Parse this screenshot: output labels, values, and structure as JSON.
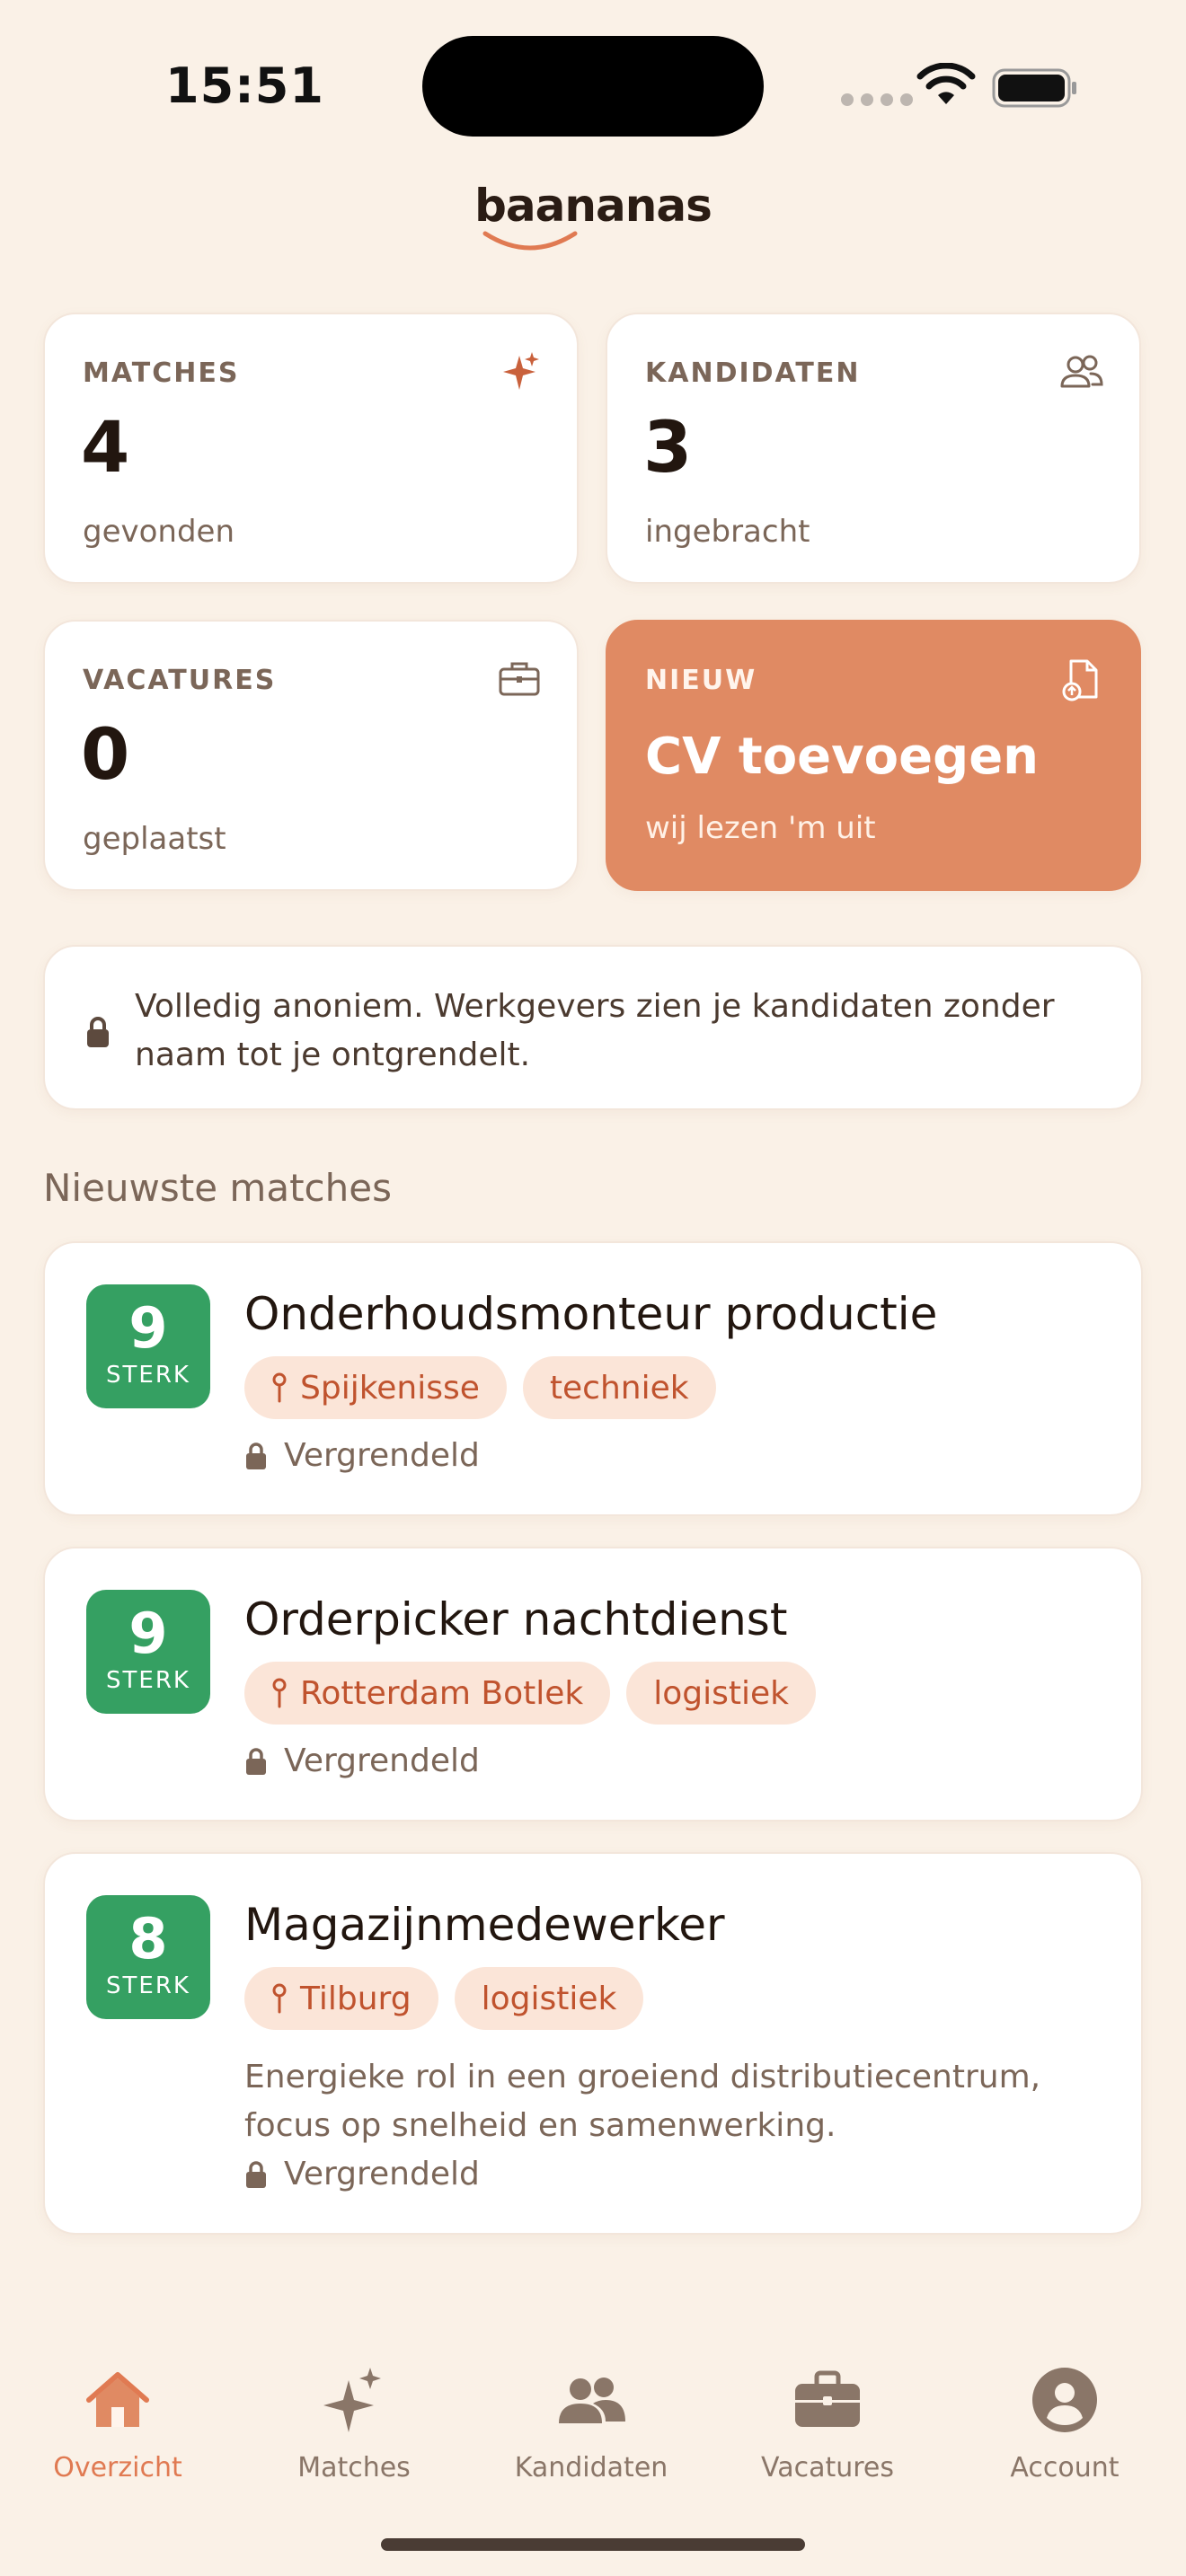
{
  "status_bar": {
    "time": "15:51"
  },
  "app": {
    "logo": "baananas"
  },
  "stats": [
    {
      "label": "MATCHES",
      "value": "4",
      "sub": "gevonden",
      "icon": "sparkle-icon"
    },
    {
      "label": "KANDIDATEN",
      "value": "3",
      "sub": "ingebracht",
      "icon": "people-icon"
    },
    {
      "label": "VACATURES",
      "value": "0",
      "sub": "geplaatst",
      "icon": "briefcase-icon"
    }
  ],
  "cta": {
    "label": "NIEUW",
    "title": "CV toevoegen",
    "sub": "wij lezen 'm uit",
    "icon": "file-upload-icon"
  },
  "notice": {
    "text": "Volledig anoniem. Werkgevers zien je kandidaten zonder naam tot je ontgrendelt.",
    "icon": "lock-icon"
  },
  "section": {
    "title": "Nieuwste matches"
  },
  "matches": [
    {
      "score": "9",
      "score_label": "STERK",
      "title": "Onderhoudsmonteur productie",
      "location": "Spijkenisse",
      "category": "techniek",
      "description": "",
      "status": "Vergrendeld"
    },
    {
      "score": "9",
      "score_label": "STERK",
      "title": "Orderpicker nachtdienst",
      "location": "Rotterdam Botlek",
      "category": "logistiek",
      "description": "",
      "status": "Vergrendeld"
    },
    {
      "score": "8",
      "score_label": "STERK",
      "title": "Magazijnmedewerker",
      "location": "Tilburg",
      "category": "logistiek",
      "description": "Energieke rol in een groeiend distributiecentrum, focus op snelheid en samenwerking.",
      "status": "Vergrendeld"
    }
  ],
  "tabbar": {
    "items": [
      {
        "label": "Overzicht",
        "icon": "house-icon",
        "active": true
      },
      {
        "label": "Matches",
        "icon": "sparkle-icon",
        "active": false
      },
      {
        "label": "Kandidaten",
        "icon": "people-icon",
        "active": false
      },
      {
        "label": "Vacatures",
        "icon": "briefcase-icon",
        "active": false
      },
      {
        "label": "Account",
        "icon": "account-icon",
        "active": false
      }
    ]
  },
  "colors": {
    "background": "#faf1e7",
    "accent": "#e08a63",
    "score_green": "#35a062",
    "tag_bg": "#fbe5d8",
    "tag_text": "#c0532e"
  }
}
